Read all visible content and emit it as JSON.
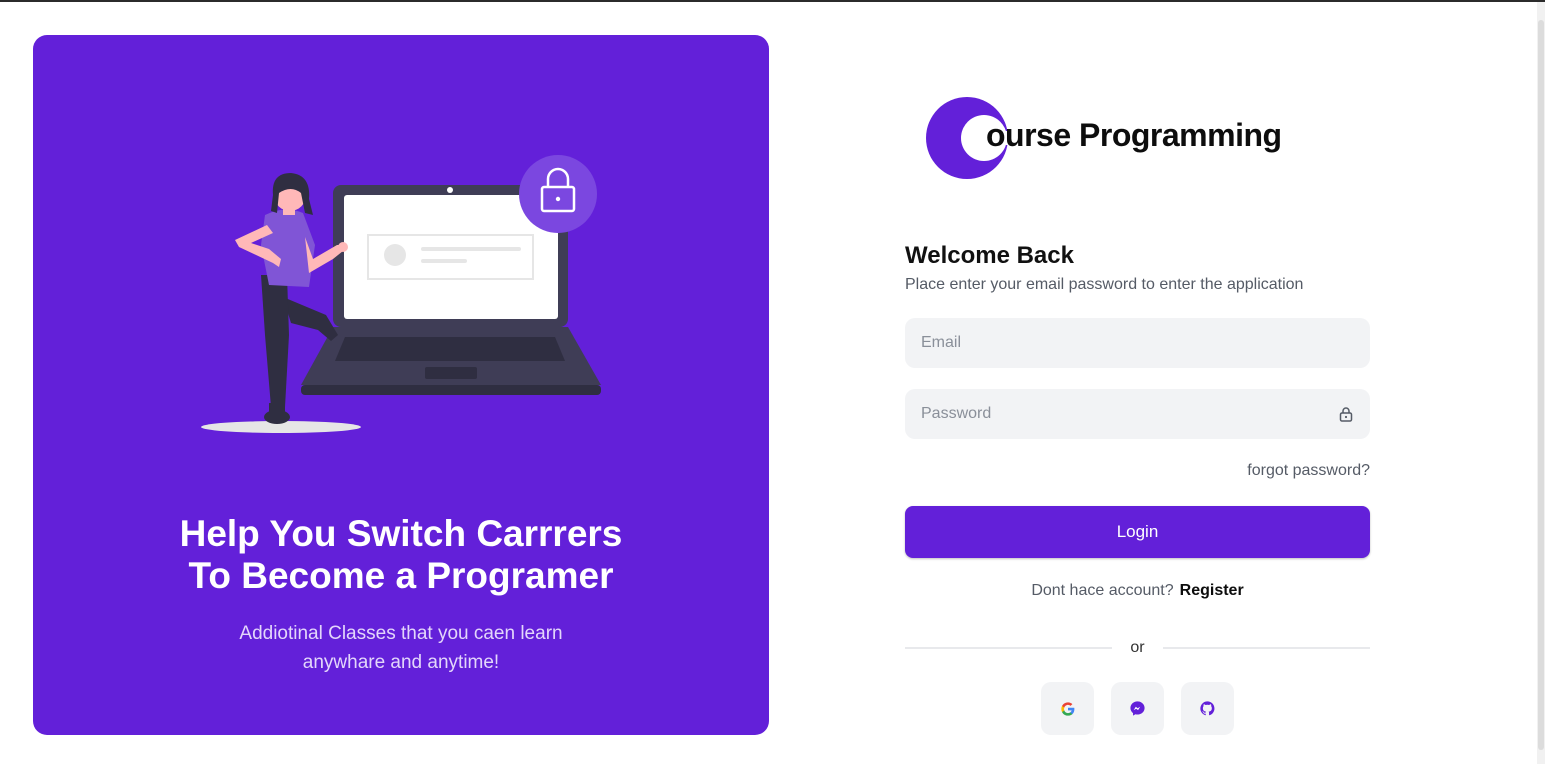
{
  "hero": {
    "title_line1": "Help You Switch Carrrers",
    "title_line2": "To Become a Programer",
    "subtitle_line1": "Addiotinal Classes that you caen learn",
    "subtitle_line2": "anywhare and anytime!"
  },
  "brand": {
    "name": "ourse Programming",
    "logo_letter": "C"
  },
  "login": {
    "title": "Welcome Back",
    "subtitle": "Place enter your email password to enter the application",
    "email_placeholder": "Email",
    "email_value": "",
    "password_placeholder": "Password",
    "password_value": "",
    "forgot_label": "forgot password?",
    "login_label": "Login",
    "no_account_text": "Dont hace account?",
    "register_label": "Register",
    "divider_text": "or"
  },
  "social": [
    {
      "name": "google",
      "icon": "google-icon"
    },
    {
      "name": "messenger",
      "icon": "messenger-icon"
    },
    {
      "name": "github",
      "icon": "github-icon"
    }
  ],
  "colors": {
    "accent": "#6320D9",
    "field_bg": "#f2f3f5",
    "text_muted": "#555b66"
  }
}
